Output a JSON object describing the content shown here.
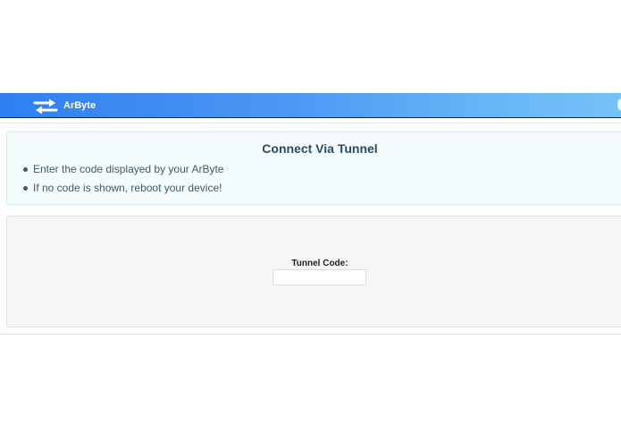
{
  "navbar": {
    "brand_name": "ArByte",
    "brand_icon": "swap-arrows-icon",
    "background_start": "#2f7ff0",
    "background_end": "#74c2f7"
  },
  "info_panel": {
    "title": "Connect Via Tunnel",
    "items": [
      "Enter the code displayed by your ArByte",
      "If no code is shown, reboot your device!"
    ],
    "background": "#f5fcfd",
    "text_color": "#3f5a6a"
  },
  "tunnel_form": {
    "label": "Tunnel Code:",
    "value": "",
    "placeholder": ""
  }
}
